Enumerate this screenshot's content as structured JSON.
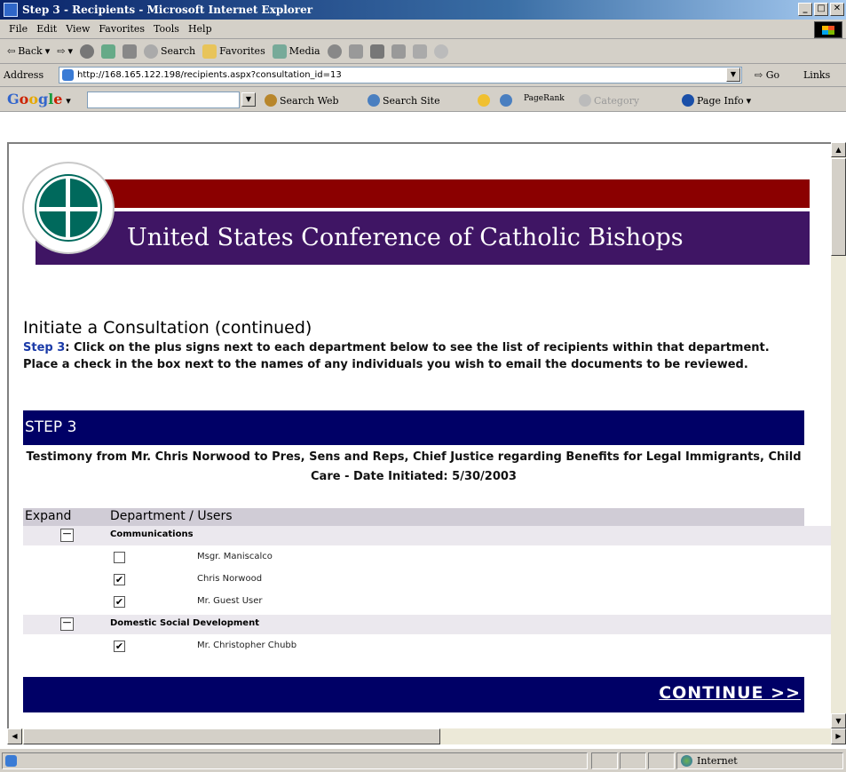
{
  "window": {
    "title": "Step 3 - Recipients - Microsoft Internet Explorer",
    "min": "_",
    "max": "□",
    "close": "✕"
  },
  "menu": {
    "items": [
      "File",
      "Edit",
      "View",
      "Favorites",
      "Tools",
      "Help"
    ]
  },
  "toolbar": {
    "back": "Back",
    "search": "Search",
    "favorites": "Favorites",
    "media": "Media"
  },
  "address": {
    "label": "Address",
    "url": "http://168.165.122.198/recipients.aspx?consultation_id=13",
    "go": "Go",
    "links": "Links"
  },
  "google_bar": {
    "search_web": "Search Web",
    "search_site": "Search Site",
    "pagerank": "PageRank",
    "category": "Category",
    "page_info": "Page Info"
  },
  "banner": {
    "title": "United States Conference of Catholic Bishops"
  },
  "page": {
    "heading": "Initiate a Consultation (continued)",
    "step_label": "Step 3",
    "instructions": ": Click on the plus signs next to each department below to see the list of recipients within that department. Place a check in the box next to the names of any individuals you wish to email the documents to be reviewed.",
    "step_bar": "STEP 3",
    "testimony": "Testimony from Mr. Chris Norwood to Pres, Sens and Reps, Chief Justice regarding Benefits for Legal Immigrants, Child Care - Date Initiated: 5/30/2003"
  },
  "table": {
    "col_expand": "Expand",
    "col_dept": "Department / Users",
    "departments": [
      {
        "name": "Communications",
        "toggle": "−",
        "users": [
          {
            "name": "Msgr. Maniscalco",
            "checked": false
          },
          {
            "name": "Chris Norwood",
            "checked": true
          },
          {
            "name": "Mr. Guest User",
            "checked": true
          }
        ]
      },
      {
        "name": "Domestic Social Development",
        "toggle": "−",
        "users": [
          {
            "name": "Mr. Christopher Chubb",
            "checked": true
          }
        ]
      }
    ]
  },
  "continue": {
    "label": "CONTINUE >>"
  },
  "status": {
    "zone": "Internet"
  }
}
